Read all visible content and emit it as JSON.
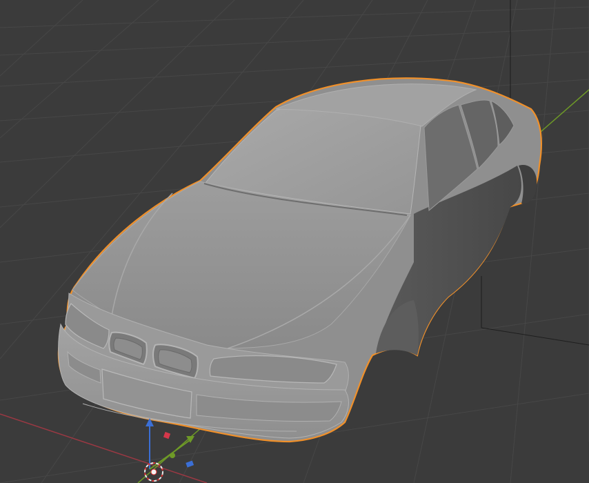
{
  "app": {
    "view": "3d-viewport",
    "shading": "solid",
    "selected_object": "car-body-mesh"
  },
  "colors": {
    "background": "#3b3b3b",
    "grid_line": "#474747",
    "axis_x": "#9b3843",
    "axis_y": "#6e9a27",
    "axis_z": "#3b6fd6",
    "selection_outline": "#f0902a",
    "mesh_light": "#a7a7a7",
    "mesh_mid": "#8b8b8b",
    "mesh_dark": "#4a4a4a"
  },
  "icons": [
    "3d-cursor-icon",
    "transform-gizmo-icon"
  ]
}
